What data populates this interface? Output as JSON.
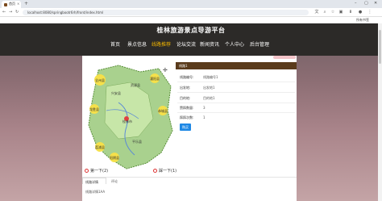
{
  "browser": {
    "tab_title": "首页",
    "tab_close": "×",
    "new_tab": "+",
    "address_url": "localhost:8080/springbootr6rh/front/index.html",
    "bookmark_label": "所有书签"
  },
  "site": {
    "title": "桂林旅游景点导游平台",
    "nav": [
      "首页",
      "景点信息",
      "线路推荐",
      "论坛交流",
      "新闻资讯",
      "个人中心",
      "后台管理"
    ],
    "active_nav": "线路推荐"
  },
  "detail": {
    "header": "线路1",
    "rows": [
      {
        "label": "线路编号:",
        "value": "线路编号1"
      },
      {
        "label": "出发地:",
        "value": "出发地1"
      },
      {
        "label": "目的地:",
        "value": "目的地1"
      },
      {
        "label": "赞踩数量:",
        "value": "3"
      },
      {
        "label": "踩踩次数:",
        "value": "1"
      }
    ],
    "button": "购买"
  },
  "map": {
    "labels": [
      "桂林市",
      "全州县",
      "灌阳县",
      "兴安县",
      "龙胜县",
      "资源县",
      "荔浦县",
      "阳朔县",
      "平乐县",
      "恭城县"
    ]
  },
  "pager": {
    "prev": "第一下(2)",
    "next": "踩一下(1)"
  },
  "lower": {
    "tab_a": "线路详情",
    "tab_b": "评论",
    "text": "线路详情1AA"
  }
}
